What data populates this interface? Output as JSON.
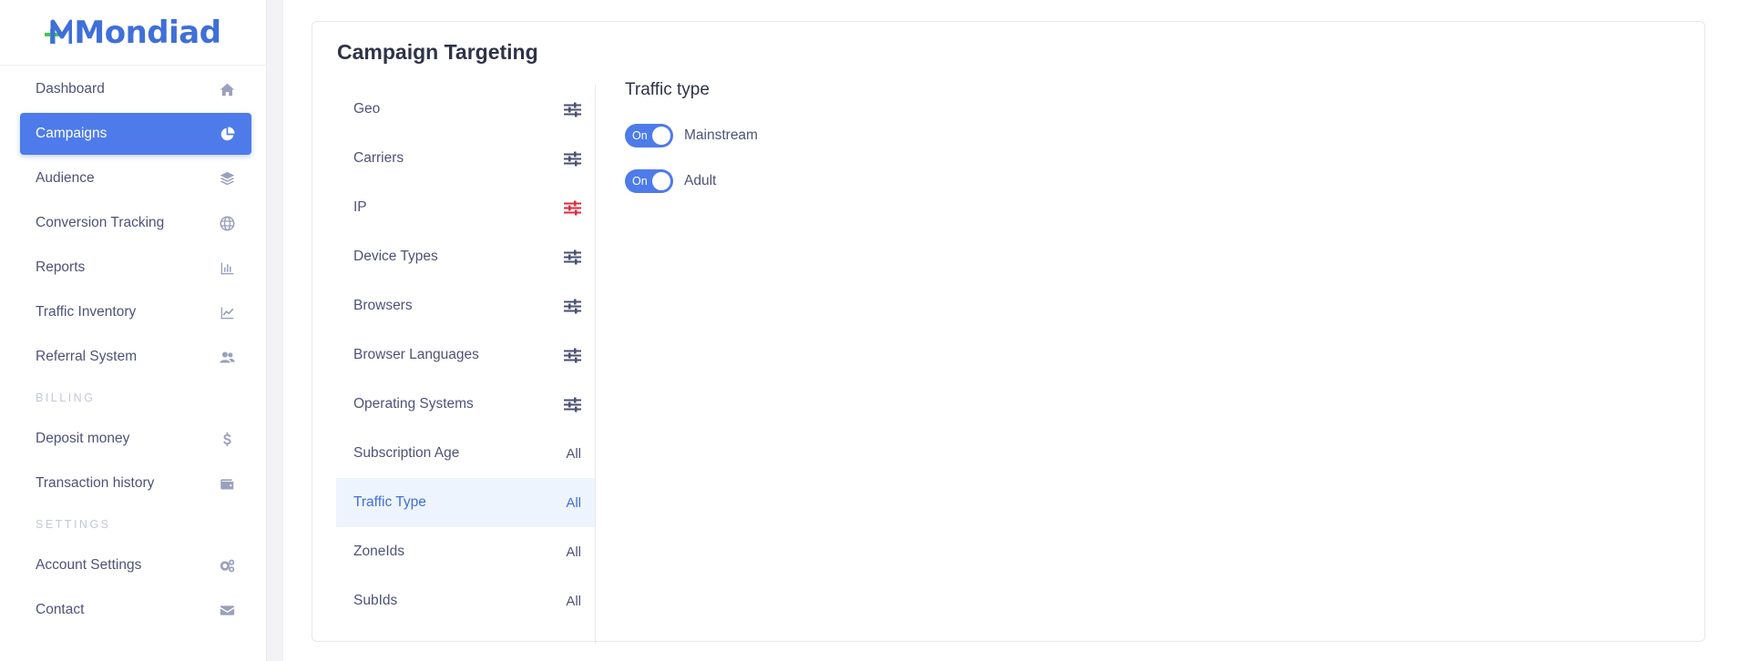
{
  "brand": {
    "name": "Mondiad",
    "color": "#3f6fd8",
    "accent": "#47c35a"
  },
  "sidebar": {
    "items": [
      {
        "label": "Dashboard",
        "icon": "home-icon"
      },
      {
        "label": "Campaigns",
        "icon": "pie-chart-icon",
        "active": true
      },
      {
        "label": "Audience",
        "icon": "layers-icon"
      },
      {
        "label": "Conversion Tracking",
        "icon": "globe-icon"
      },
      {
        "label": "Reports",
        "icon": "bar-chart-icon"
      },
      {
        "label": "Traffic Inventory",
        "icon": "line-chart-icon"
      },
      {
        "label": "Referral System",
        "icon": "users-icon"
      }
    ],
    "billing_title": "BILLING",
    "billing_items": [
      {
        "label": "Deposit money",
        "icon": "dollar-icon"
      },
      {
        "label": "Transaction history",
        "icon": "wallet-icon"
      }
    ],
    "settings_title": "SETTINGS",
    "settings_items": [
      {
        "label": "Account Settings",
        "icon": "cogs-icon"
      },
      {
        "label": "Contact",
        "icon": "envelope-icon"
      }
    ]
  },
  "card": {
    "title": "Campaign Targeting",
    "targets": [
      {
        "label": "Geo",
        "value": "",
        "icon": "sliders-icon",
        "icon_color": "#4a5072"
      },
      {
        "label": "Carriers",
        "value": "",
        "icon": "sliders-icon",
        "icon_color": "#4a5072"
      },
      {
        "label": "IP",
        "value": "",
        "icon": "sliders-icon",
        "icon_color": "#e02b3f"
      },
      {
        "label": "Device Types",
        "value": "",
        "icon": "sliders-icon",
        "icon_color": "#4a5072"
      },
      {
        "label": "Browsers",
        "value": "",
        "icon": "sliders-icon",
        "icon_color": "#4a5072"
      },
      {
        "label": "Browser Languages",
        "value": "",
        "icon": "sliders-icon",
        "icon_color": "#4a5072"
      },
      {
        "label": "Operating Systems",
        "value": "",
        "icon": "sliders-icon",
        "icon_color": "#4a5072"
      },
      {
        "label": "Subscription Age",
        "value": "All"
      },
      {
        "label": "Traffic Type",
        "value": "All",
        "active": true
      },
      {
        "label": "ZoneIds",
        "value": "All"
      },
      {
        "label": "SubIds",
        "value": "All"
      }
    ],
    "detail": {
      "title": "Traffic type",
      "toggles": [
        {
          "state_label": "On",
          "name": "Mainstream"
        },
        {
          "state_label": "On",
          "name": "Adult"
        }
      ]
    }
  }
}
